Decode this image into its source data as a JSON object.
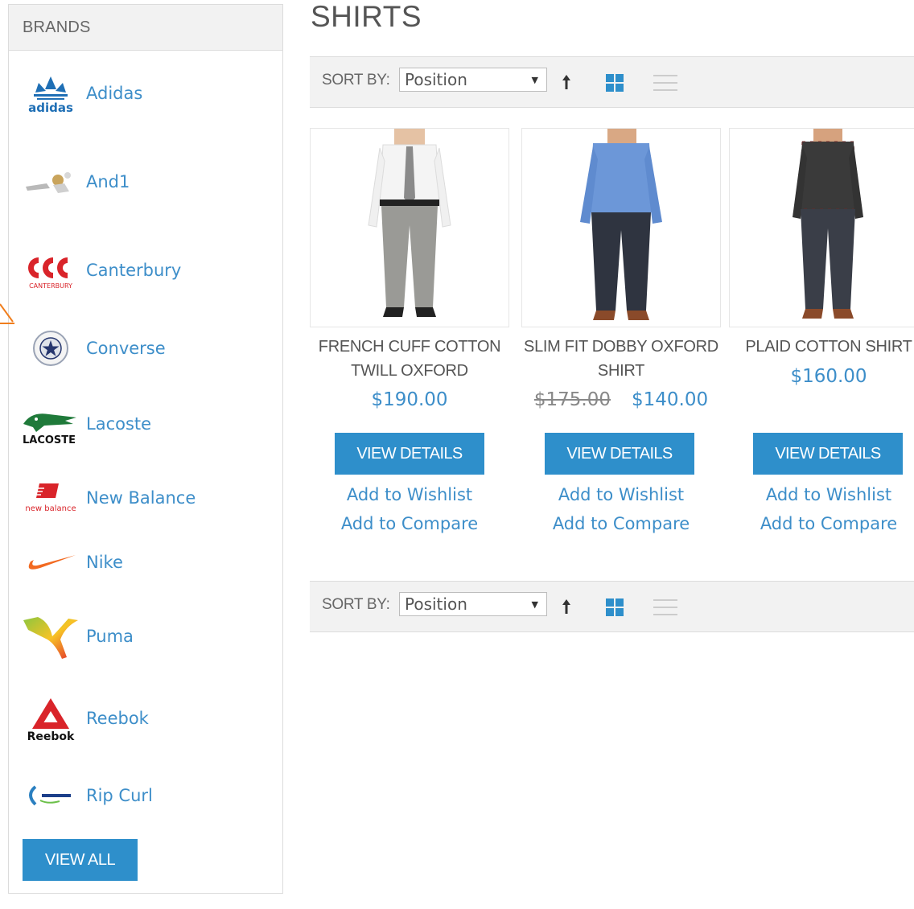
{
  "sidebar": {
    "title": "BRANDS",
    "brands": [
      {
        "name": "Adidas",
        "logo": "adidas-logo"
      },
      {
        "name": "And1",
        "logo": "and1-logo"
      },
      {
        "name": "Canterbury",
        "logo": "canterbury-logo"
      },
      {
        "name": "Converse",
        "logo": "converse-logo"
      },
      {
        "name": "Lacoste",
        "logo": "lacoste-logo"
      },
      {
        "name": "New Balance",
        "logo": "new-balance-logo"
      },
      {
        "name": "Nike",
        "logo": "nike-logo"
      },
      {
        "name": "Puma",
        "logo": "puma-logo"
      },
      {
        "name": "Reebok",
        "logo": "reebok-logo"
      },
      {
        "name": "Rip Curl",
        "logo": "rip-curl-logo"
      }
    ],
    "view_all": "VIEW ALL"
  },
  "page": {
    "title": "SHIRTS"
  },
  "toolbar": {
    "sort_label": "SORT BY:",
    "sort_value": "Position",
    "icons": [
      "sort-direction-arrow-icon",
      "grid-view-icon",
      "list-view-icon"
    ]
  },
  "products": [
    {
      "name": "FRENCH CUFF COTTON TWILL OXFORD",
      "price": "$190.00",
      "old_price": "",
      "shirt_color": "#f4f4f4",
      "pants_color": "#9a9a96"
    },
    {
      "name": "SLIM FIT DOBBY OXFORD SHIRT",
      "price": "$140.00",
      "old_price": "$175.00",
      "shirt_color": "#6c97d8",
      "pants_color": "#2f3440"
    },
    {
      "name": "PLAID COTTON SHIRT",
      "price": "$160.00",
      "old_price": "",
      "shirt_color": "#3a3a3a",
      "pants_color": "#3a3e48"
    }
  ],
  "actions": {
    "view_details": "VIEW DETAILS",
    "wishlist": "Add to Wishlist",
    "compare": "Add to Compare"
  },
  "colors": {
    "accent": "#2e8fcb",
    "link": "#3d8ec9",
    "toolbar_bg": "#f2f2f2"
  },
  "logo_text": {
    "adidas": "adidas",
    "canterbury": "CANTERBURY",
    "lacoste": "LACOSTE",
    "new_balance": "new balance",
    "reebok": "Reebok"
  }
}
